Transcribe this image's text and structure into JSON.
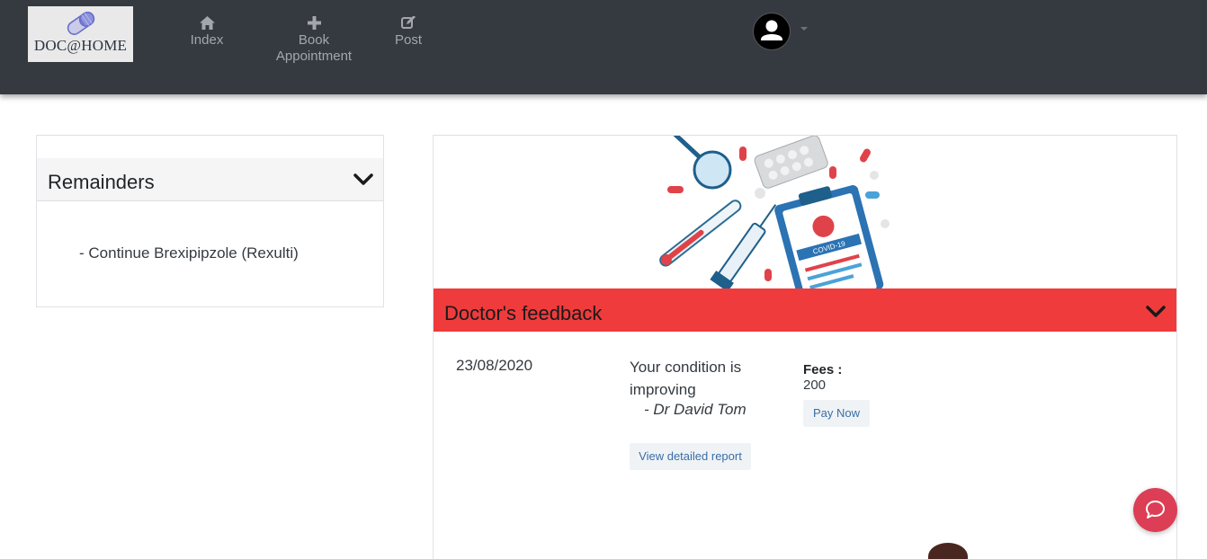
{
  "navbar": {
    "logo_text": "DOC@HOME",
    "items": [
      {
        "label": "Index",
        "icon": "home-icon"
      },
      {
        "label": "Book Appointment",
        "icon": "plus-icon"
      },
      {
        "label": "Post",
        "icon": "edit-icon"
      }
    ],
    "avatar_icon": "user-icon"
  },
  "reminders": {
    "title": "Remainders",
    "items": [
      "- Continue Brexipipzole (Rexulti)"
    ]
  },
  "feedback": {
    "title": "Doctor's feedback",
    "date": "23/08/2020",
    "message": "Your condition is improving",
    "signature": "- Dr David Tom",
    "view_report_label": "View detailed report",
    "fees_label": "Fees :",
    "fees_value": "200",
    "pay_label": "Pay Now"
  },
  "colors": {
    "navbar_bg": "#343a40",
    "feedback_header": "#ef3b3c",
    "chat_button": "#dc3e55",
    "link_blue": "#3a6ea5"
  }
}
